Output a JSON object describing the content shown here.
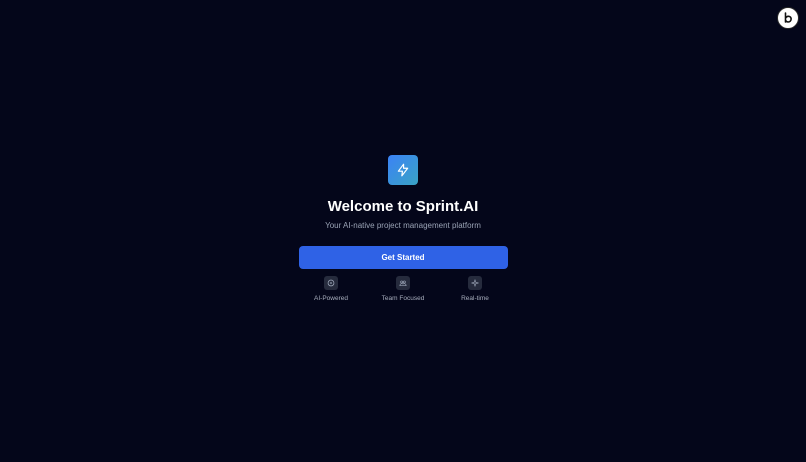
{
  "app": {
    "title": "Welcome to Sprint.AI",
    "subtitle": "Your AI-native project management platform",
    "logo_icon": "lightning-bolt-icon",
    "corner_badge_icon": "b-logo-icon",
    "cta_label": "Get Started"
  },
  "features": [
    {
      "label": "AI-Powered",
      "icon": "circle-dot-icon"
    },
    {
      "label": "Team Focused",
      "icon": "team-icon"
    },
    {
      "label": "Real-time",
      "icon": "sparkle-icon"
    }
  ],
  "colors": {
    "background": "#04061a",
    "accent": "#2f62e6",
    "logo_gradient_start": "#3b82f6",
    "logo_gradient_end": "#3aa3c4",
    "title": "#ffffff",
    "subtitle": "#9aa3b5"
  }
}
